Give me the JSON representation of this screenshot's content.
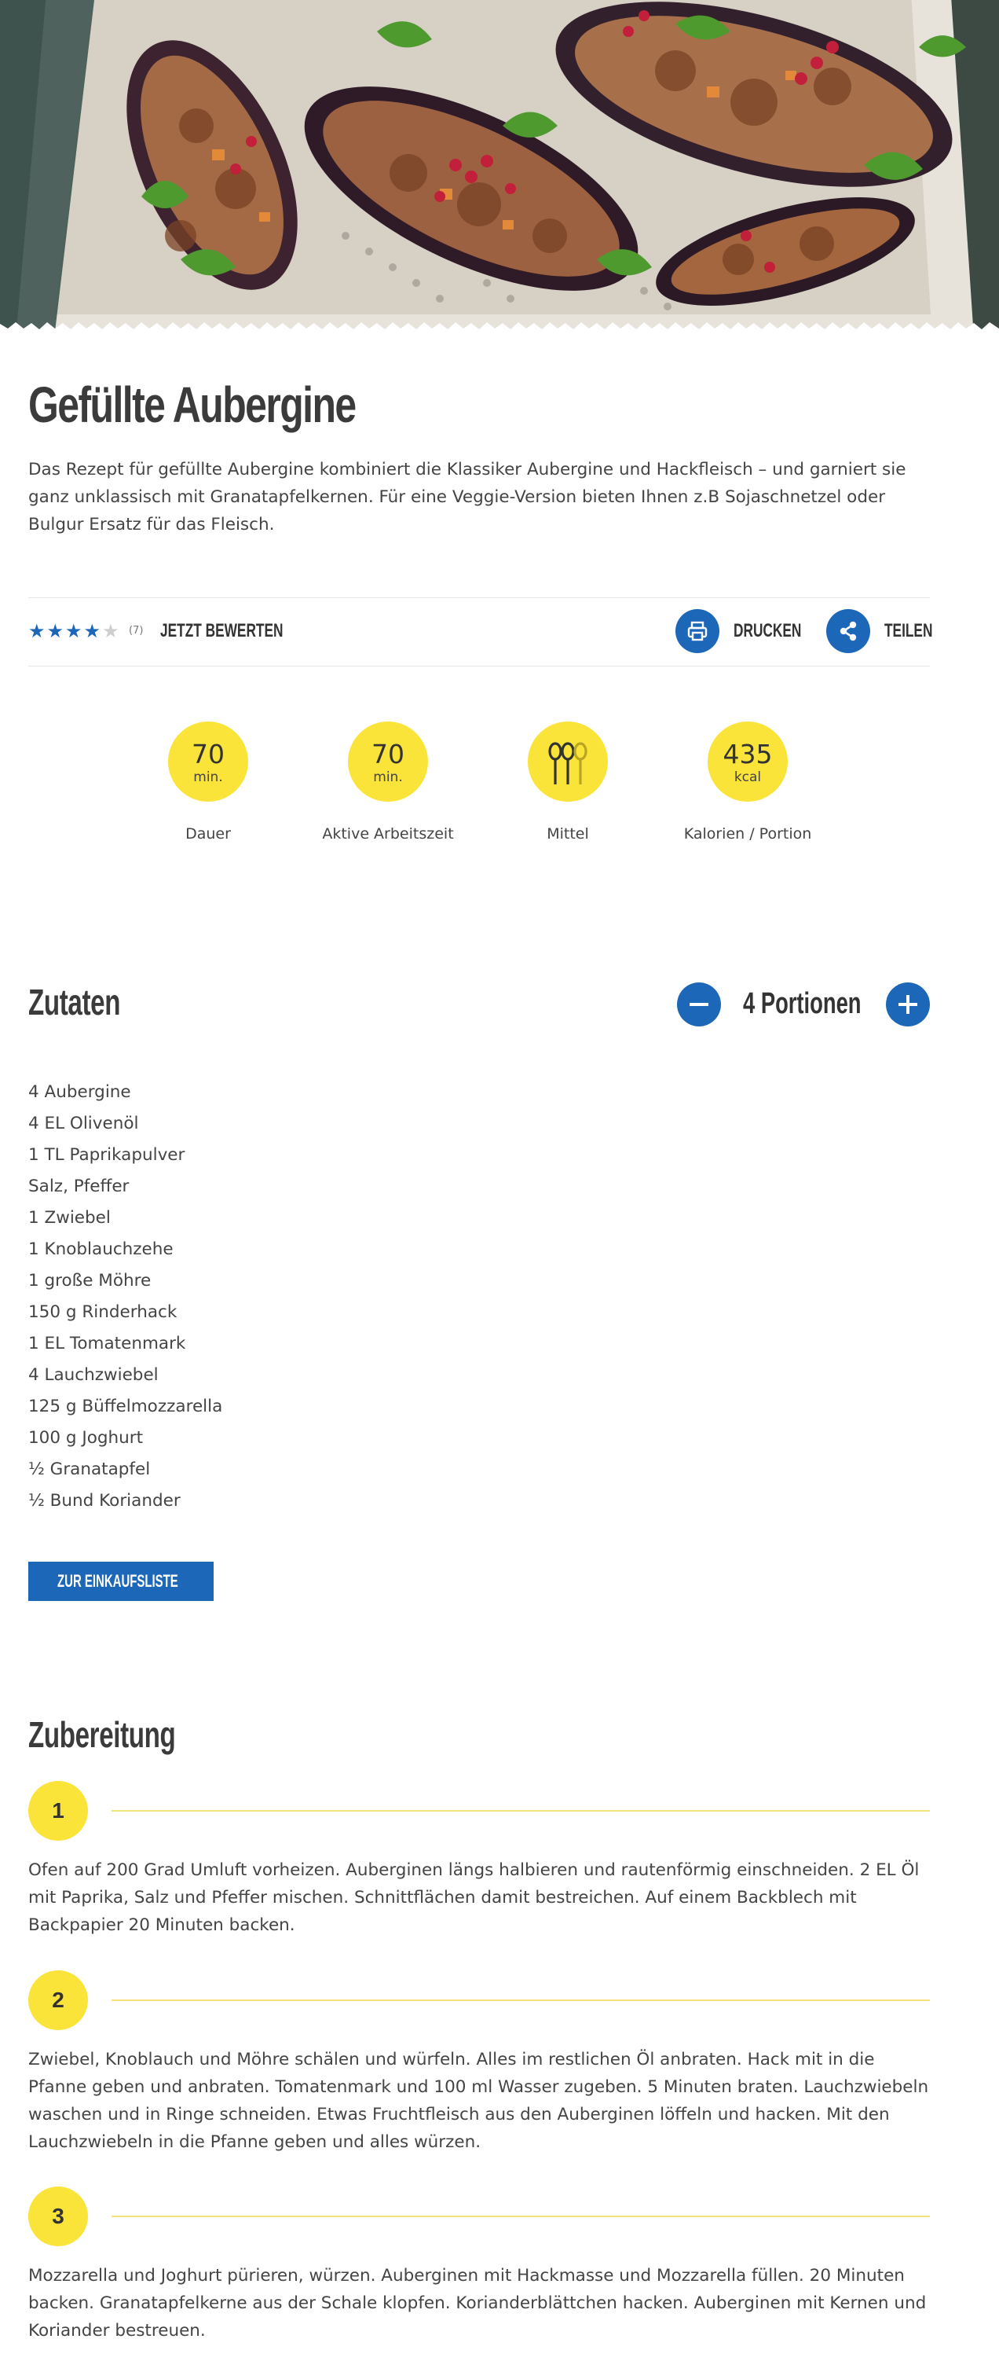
{
  "recipe": {
    "title": "Gefüllte Aubergine",
    "intro": "Das Rezept für gefüllte Aubergine kombiniert die Klassiker Aubergine und Hackfleisch – und garniert sie ganz unklassisch mit Granatapfelkernen. Für eine Veggie-Version bieten Ihnen z.B Sojaschnetzel oder Bulgur Ersatz für das Fleisch."
  },
  "rating": {
    "stars_filled": 4,
    "stars_total": 5,
    "count": "(7)",
    "rate_label": "JETZT BEWERTEN"
  },
  "actions": {
    "print_label": "DRUCKEN",
    "share_label": "TEILEN"
  },
  "facts": [
    {
      "value": "70",
      "unit": "min.",
      "caption": "Dauer"
    },
    {
      "value": "70",
      "unit": "min.",
      "caption": "Aktive Arbeitszeit"
    },
    {
      "value": "",
      "unit": "",
      "caption": "Mittel",
      "icon": "difficulty-spoons-icon"
    },
    {
      "value": "435",
      "unit": "kcal",
      "caption": "Kalorien / Portion"
    }
  ],
  "ingredients_section": {
    "heading": "Zutaten",
    "portions_label": "4 Portionen",
    "items": [
      "4 Aubergine",
      "4 EL Olivenöl",
      "1 TL Paprikapulver",
      "Salz, Pfeffer",
      "1 Zwiebel",
      "1 Knoblauchzehe",
      "1 große Möhre",
      "150 g Rinderhack",
      "1 EL Tomatenmark",
      "4 Lauchzwiebel",
      "125 g Büffelmozzarella",
      "100 g Joghurt",
      "½ Granatapfel",
      "½ Bund Koriander"
    ],
    "shopping_button": "ZUR EINKAUFSLISTE"
  },
  "preparation": {
    "heading": "Zubereitung",
    "steps": [
      {
        "number": "1",
        "text": "Ofen auf 200 Grad Umluft vorheizen. Auberginen längs halbieren und rautenförmig einschneiden. 2 EL Öl mit Paprika, Salz und Pfeffer mischen. Schnittflächen damit bestreichen. Auf einem Backblech mit Backpapier 20 Minuten backen."
      },
      {
        "number": "2",
        "text": "Zwiebel, Knoblauch und Möhre schälen und würfeln. Alles im restlichen Öl anbraten. Hack mit in die Pfanne geben und anbraten. Tomatenmark und 100 ml Wasser zugeben. 5 Minuten braten. Lauchzwiebeln waschen und in Ringe schneiden. Etwas Fruchtfleisch aus den Auberginen löffeln und hacken. Mit den Lauchzwiebeln in die Pfanne geben und alles würzen."
      },
      {
        "number": "3",
        "text": "Mozzarella und Joghurt pürieren, würzen. Auberginen mit Hackmasse und Mozzarella füllen. 20 Minuten backen. Granatapfelkerne aus der Schale klopfen. Korianderblättchen hacken. Auberginen mit Kernen und Koriander bestreuen."
      }
    ]
  },
  "colors": {
    "accent_blue": "#1d67b8",
    "accent_yellow": "#fbe43a",
    "text": "#3a3a3a"
  }
}
